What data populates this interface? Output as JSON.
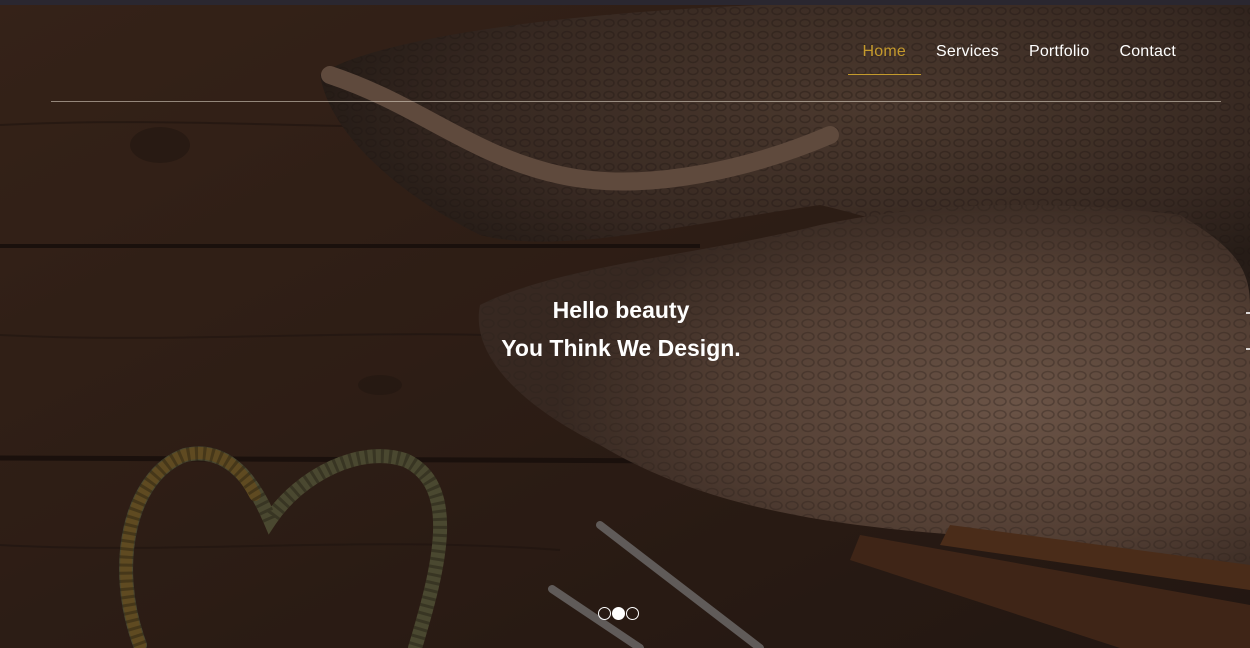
{
  "nav": {
    "items": [
      {
        "label": "Home",
        "active": true
      },
      {
        "label": "Services",
        "active": false
      },
      {
        "label": "Portfolio",
        "active": false
      },
      {
        "label": "Contact",
        "active": false
      }
    ],
    "active_color": "#c49a2c"
  },
  "hero": {
    "line1": "Hello beauty",
    "line2": "You Think We Design.",
    "background": "crochet-knitting-photo",
    "slider": {
      "total": 3,
      "current": 2
    }
  },
  "colors": {
    "accent": "#c49a2c",
    "text": "#ffffff"
  }
}
